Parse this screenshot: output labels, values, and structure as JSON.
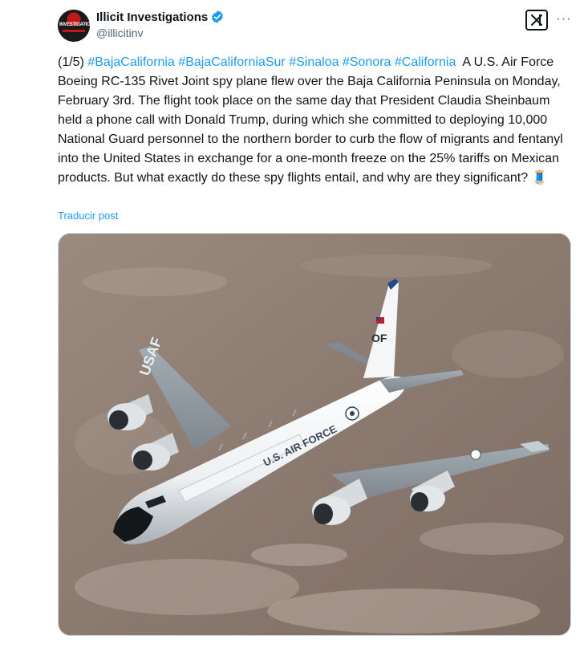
{
  "account": {
    "display_name": "Illicit Investigations",
    "handle": "@illicitinv",
    "avatar_text": "INVESTIGATIONS",
    "verified": true
  },
  "actions": {
    "grok_icon": "grok-icon",
    "more_label": "···"
  },
  "tweet": {
    "prefix": "(1/5)",
    "hashtags": [
      "#BajaCalifornia",
      "#BajaCaliforniaSur",
      "#Sinaloa",
      "#Sonora",
      "#California"
    ],
    "body": "A U.S. Air Force Boeing RC-135 Rivet Joint spy plane flew over the Baja California Peninsula on Monday, February 3rd. The flight took place on the same day that President Claudia Sheinbaum held a phone call with Donald Trump, during which she committed to deploying 10,000 National Guard personnel to the northern border to curb the flow of migrants and fentanyl into the United States in exchange for a one-month freeze on the 25% tariffs on Mexican products. But what exactly do these spy flights entail, and why are they significant?",
    "emoji": "🧵",
    "translate_label": "Traducir post"
  },
  "media": {
    "tail_code": "OF",
    "wing_text": "USAF",
    "fuselage_text": "U.S. AIR FORCE"
  },
  "colors": {
    "link": "#1d9bf0",
    "verified": "#1d9bf0",
    "text": "#0f1419",
    "muted": "#536471"
  }
}
